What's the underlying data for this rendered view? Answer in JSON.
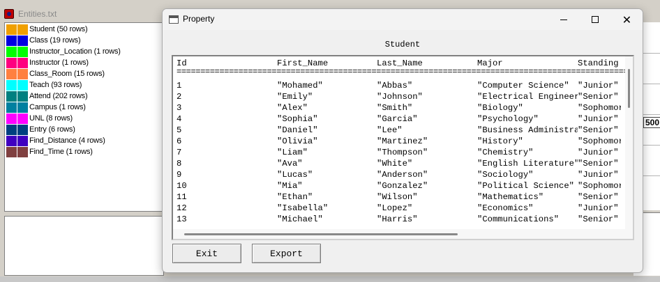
{
  "main_window": {
    "title": "Entities.txt"
  },
  "entities": [
    {
      "label": "Student (50 rows)",
      "color_a": "#f0a000",
      "color_b": "#f0a000",
      "icon": "table-swatch-icon"
    },
    {
      "label": "Class (19 rows)",
      "color_a": "#0000e0",
      "color_b": "#0000e0",
      "icon": "table-swatch-icon"
    },
    {
      "label": "Instructor_Location (1 rows)",
      "color_a": "#00ff00",
      "color_b": "#00ff00",
      "icon": "table-swatch-icon"
    },
    {
      "label": "Instructor (1 rows)",
      "color_a": "#ff0080",
      "color_b": "#ff0080",
      "icon": "table-swatch-icon"
    },
    {
      "label": "Class_Room (15 rows)",
      "color_a": "#ff8040",
      "color_b": "#ff8040",
      "icon": "table-swatch-icon"
    },
    {
      "label": "Teach (93 rows)",
      "color_a": "#00ffff",
      "color_b": "#00ffff",
      "icon": "table-swatch-icon"
    },
    {
      "label": "Attend (202 rows)",
      "color_a": "#008080",
      "color_b": "#008080",
      "icon": "table-swatch-icon"
    },
    {
      "label": "Campus (1 rows)",
      "color_a": "#0080a0",
      "color_b": "#0080a0",
      "icon": "table-swatch-icon"
    },
    {
      "label": "UNL (8 rows)",
      "color_a": "#ff00ff",
      "color_b": "#ff00ff",
      "icon": "table-swatch-icon"
    },
    {
      "label": "Entry (6 rows)",
      "color_a": "#004080",
      "color_b": "#004080",
      "icon": "table-swatch-icon"
    },
    {
      "label": "Find_Distance (4 rows)",
      "color_a": "#4000c0",
      "color_b": "#4000c0",
      "icon": "table-swatch-icon"
    },
    {
      "label": "Find_Time (1 rows)",
      "color_a": "#804040",
      "color_b": "#804040",
      "icon": "table-swatch-icon"
    }
  ],
  "canvas": {
    "value_label": "500"
  },
  "dialog": {
    "title": "Property",
    "caption": "Student",
    "columns": [
      "Id",
      "First_Name",
      "Last_Name",
      "Major",
      "Standing"
    ],
    "separator": "=========================================================================================================",
    "rows": [
      [
        "1",
        "\"Mohamed\"",
        "\"Abbas\"",
        "\"Computer Science\"",
        "\"Junior\""
      ],
      [
        "2",
        "\"Emily\"",
        "\"Johnson\"",
        "\"Electrical Engineering\"",
        "\"Senior\""
      ],
      [
        "3",
        "\"Alex\"",
        "\"Smith\"",
        "\"Biology\"",
        "\"Sophomore\""
      ],
      [
        "4",
        "\"Sophia\"",
        "\"Garcia\"",
        "\"Psychology\"",
        "\"Junior\""
      ],
      [
        "5",
        "\"Daniel\"",
        "\"Lee\"",
        "\"Business Administration\"",
        "\"Senior\""
      ],
      [
        "6",
        "\"Olivia\"",
        "\"Martinez\"",
        "\"History\"",
        "\"Sophomore\""
      ],
      [
        "7",
        "\"Liam\"",
        "\"Thompson\"",
        "\"Chemistry\"",
        "\"Junior\""
      ],
      [
        "8",
        "\"Ava\"",
        "\"White\"",
        "\"English Literature\"",
        "\"Senior\""
      ],
      [
        "9",
        "\"Lucas\"",
        "\"Anderson\"",
        "\"Sociology\"",
        "\"Junior\""
      ],
      [
        "10",
        "\"Mia\"",
        "\"Gonzalez\"",
        "\"Political Science\"",
        "\"Sophomore\""
      ],
      [
        "11",
        "\"Ethan\"",
        "\"Wilson\"",
        "\"Mathematics\"",
        "\"Senior\""
      ],
      [
        "12",
        "\"Isabella\"",
        "\"Lopez\"",
        "\"Economics\"",
        "\"Junior\""
      ],
      [
        "13",
        "\"Michael\"",
        "\"Harris\"",
        "\"Communications\"",
        "\"Senior\""
      ]
    ],
    "buttons": {
      "exit": "Exit",
      "export": "Export"
    },
    "window_controls": {
      "minimize": "minimize-icon",
      "maximize": "maximize-icon",
      "close": "close-icon"
    }
  }
}
